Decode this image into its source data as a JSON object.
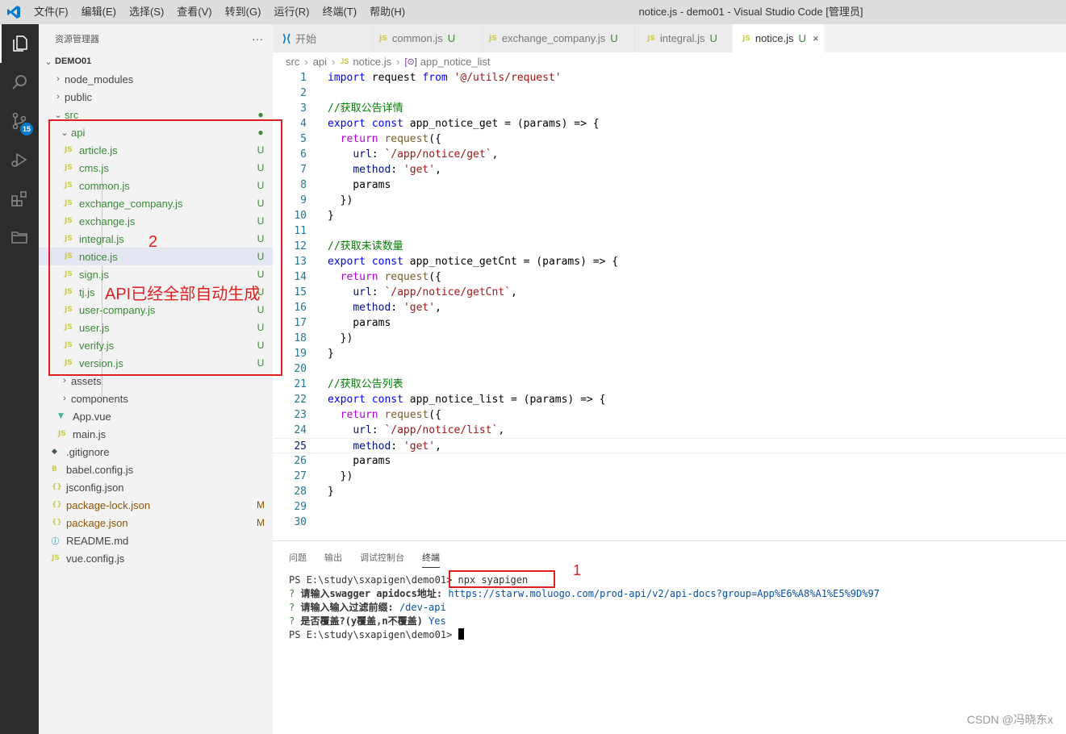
{
  "window": {
    "title": "notice.js - demo01 - Visual Studio Code [管理员]",
    "menu": [
      "文件(F)",
      "编辑(E)",
      "选择(S)",
      "查看(V)",
      "转到(G)",
      "运行(R)",
      "终端(T)",
      "帮助(H)"
    ]
  },
  "activity": {
    "scm_badge": "15"
  },
  "sidebar": {
    "title": "资源管理器",
    "more": "···",
    "root": "DEMO01",
    "items": [
      {
        "label": "node_modules",
        "icon": "›",
        "status": ""
      },
      {
        "label": "public",
        "icon": "›",
        "status": ""
      },
      {
        "label": "src",
        "icon": "⌄",
        "status": "●"
      },
      {
        "label": "api",
        "icon": "⌄",
        "status": "●"
      },
      {
        "label": "article.js",
        "icon": "JS",
        "status": "U"
      },
      {
        "label": "cms.js",
        "icon": "JS",
        "status": "U"
      },
      {
        "label": "common.js",
        "icon": "JS",
        "status": "U"
      },
      {
        "label": "exchange_company.js",
        "icon": "JS",
        "status": "U"
      },
      {
        "label": "exchange.js",
        "icon": "JS",
        "status": "U"
      },
      {
        "label": "integral.js",
        "icon": "JS",
        "status": "U"
      },
      {
        "label": "notice.js",
        "icon": "JS",
        "status": "U"
      },
      {
        "label": "sign.js",
        "icon": "JS",
        "status": "U"
      },
      {
        "label": "tj.js",
        "icon": "JS",
        "status": "U"
      },
      {
        "label": "user-company.js",
        "icon": "JS",
        "status": "U"
      },
      {
        "label": "user.js",
        "icon": "JS",
        "status": "U"
      },
      {
        "label": "verify.js",
        "icon": "JS",
        "status": "U"
      },
      {
        "label": "version.js",
        "icon": "JS",
        "status": "U"
      },
      {
        "label": "assets",
        "icon": "›",
        "status": ""
      },
      {
        "label": "components",
        "icon": "›",
        "status": ""
      },
      {
        "label": "App.vue",
        "icon": "▼",
        "status": ""
      },
      {
        "label": "main.js",
        "icon": "JS",
        "status": ""
      },
      {
        "label": ".gitignore",
        "icon": "◆",
        "status": ""
      },
      {
        "label": "babel.config.js",
        "icon": "B",
        "status": ""
      },
      {
        "label": "jsconfig.json",
        "icon": "{}",
        "status": ""
      },
      {
        "label": "package-lock.json",
        "icon": "{}",
        "status": "M"
      },
      {
        "label": "package.json",
        "icon": "{}",
        "status": "M"
      },
      {
        "label": "README.md",
        "icon": "ⓘ",
        "status": ""
      },
      {
        "label": "vue.config.js",
        "icon": "JS",
        "status": ""
      }
    ]
  },
  "annotations": {
    "api_number": "2",
    "api_note": "API已经全部自动生成",
    "cmd_number": "1"
  },
  "tabs": [
    {
      "label": "开始",
      "badge": "",
      "close": ""
    },
    {
      "label": "common.js",
      "badge": "U",
      "close": ""
    },
    {
      "label": "exchange_company.js",
      "badge": "U",
      "close": ""
    },
    {
      "label": "integral.js",
      "badge": "U",
      "close": ""
    },
    {
      "label": "notice.js",
      "badge": "U",
      "close": "×"
    }
  ],
  "breadcrumb": {
    "a": "src",
    "b": "api",
    "c": "notice.js",
    "d": "app_notice_list"
  },
  "editor": {
    "current_line": 25,
    "lines": [
      "import request from '@/utils/request'",
      "",
      "//获取公告详情",
      "export const app_notice_get = (params) => {",
      "  return request({",
      "    url: `/app/notice/get`,",
      "    method: 'get',",
      "    params",
      "  })",
      "}",
      "",
      "//获取未读数量",
      "export const app_notice_getCnt = (params) => {",
      "  return request({",
      "    url: `/app/notice/getCnt`,",
      "    method: 'get',",
      "    params",
      "  })",
      "}",
      "",
      "//获取公告列表",
      "export const app_notice_list = (params) => {",
      "  return request({",
      "    url: `/app/notice/list`,",
      "    method: 'get',",
      "    params",
      "  })",
      "}",
      "",
      ""
    ]
  },
  "panel": {
    "tabs": [
      "问题",
      "输出",
      "调试控制台",
      "终端"
    ],
    "active_tab": "终端",
    "terminal": {
      "prompt": "PS E:\\study\\sxapigen\\demo01>",
      "command": "npx syapigen",
      "q1_mark": "?",
      "q1_label": "请输入swagger apidocs地址:",
      "q1_answer": "https://starw.moluogo.com/prod-api/v2/api-docs?group=App%E6%A8%A1%E5%9D%97",
      "q2_label": "请输入输入过滤前缀:",
      "q2_answer": "/dev-api",
      "q3_label": "是否覆盖?(y覆盖,n不覆盖)",
      "q3_answer": "Yes",
      "prompt2": "PS E:\\study\\sxapigen\\demo01>"
    }
  },
  "watermark": "CSDN @冯晓东x"
}
